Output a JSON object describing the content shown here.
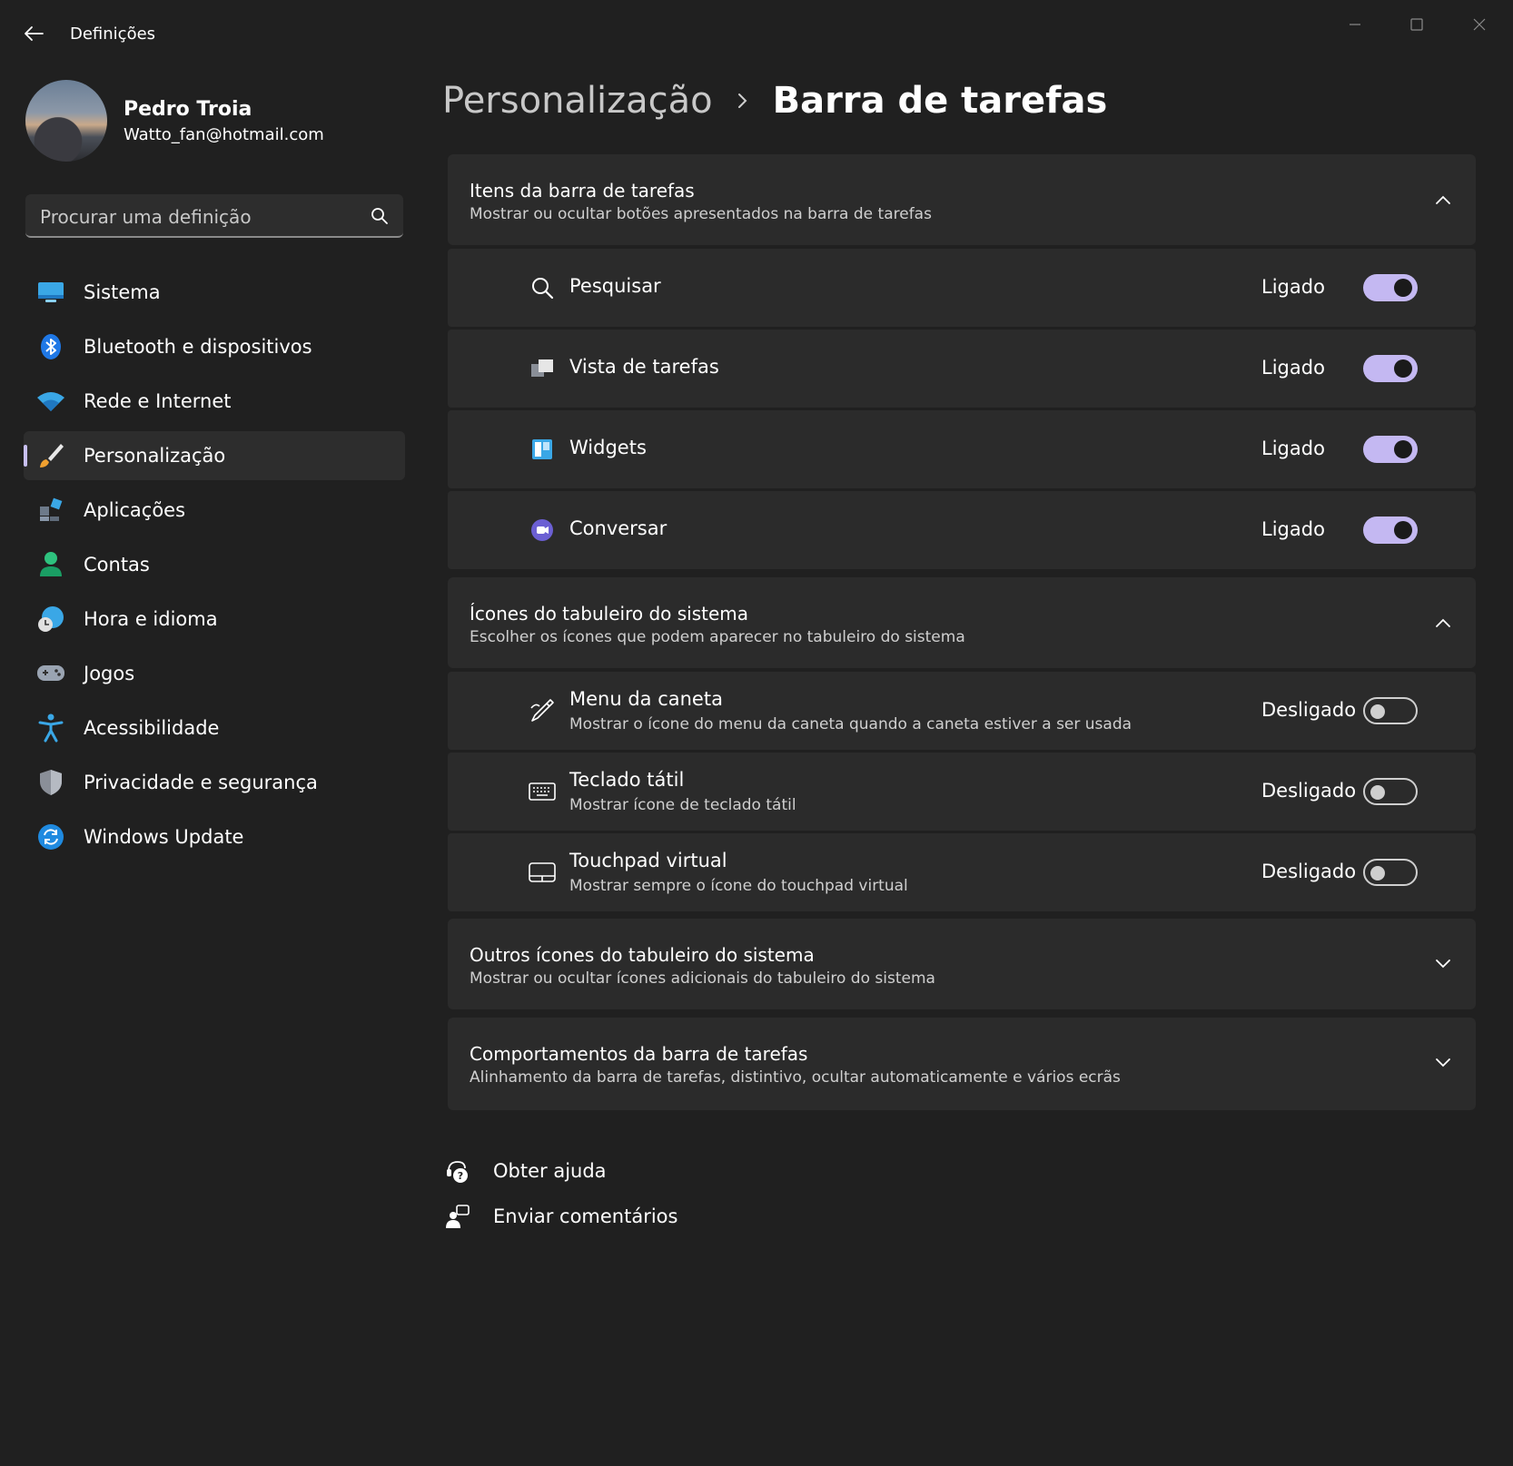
{
  "window": {
    "title": "Definições"
  },
  "profile": {
    "name": "Pedro Troia",
    "email": "Watto_fan@hotmail.com"
  },
  "search": {
    "placeholder": "Procurar uma definição"
  },
  "nav": {
    "items": [
      {
        "label": "Sistema",
        "icon": "monitor-icon"
      },
      {
        "label": "Bluetooth e dispositivos",
        "icon": "bluetooth-icon"
      },
      {
        "label": "Rede e Internet",
        "icon": "wifi-icon"
      },
      {
        "label": "Personalização",
        "icon": "brush-icon",
        "active": true
      },
      {
        "label": "Aplicações",
        "icon": "apps-icon"
      },
      {
        "label": "Contas",
        "icon": "person-icon"
      },
      {
        "label": "Hora e idioma",
        "icon": "globe-clock-icon"
      },
      {
        "label": "Jogos",
        "icon": "gamepad-icon"
      },
      {
        "label": "Acessibilidade",
        "icon": "accessibility-icon"
      },
      {
        "label": "Privacidade e segurança",
        "icon": "shield-icon"
      },
      {
        "label": "Windows Update",
        "icon": "update-icon"
      }
    ]
  },
  "breadcrumb": {
    "parent": "Personalização",
    "current": "Barra de tarefas"
  },
  "sections": {
    "taskbar_items": {
      "title": "Itens da barra de tarefas",
      "subtitle": "Mostrar ou ocultar botões apresentados na barra de tarefas",
      "expanded": true,
      "rows": [
        {
          "title": "Pesquisar",
          "state": "Ligado",
          "on": true,
          "icon": "search-icon"
        },
        {
          "title": "Vista de tarefas",
          "state": "Ligado",
          "on": true,
          "icon": "task-view-icon"
        },
        {
          "title": "Widgets",
          "state": "Ligado",
          "on": true,
          "icon": "widgets-icon"
        },
        {
          "title": "Conversar",
          "state": "Ligado",
          "on": true,
          "icon": "chat-icon"
        }
      ]
    },
    "tray_icons": {
      "title": "Ícones do tabuleiro do sistema",
      "subtitle": "Escolher os ícones que podem aparecer no tabuleiro do sistema",
      "expanded": true,
      "rows": [
        {
          "title": "Menu da caneta",
          "subtitle": "Mostrar o ícone do menu da caneta quando a caneta estiver a ser usada",
          "state": "Desligado",
          "on": false,
          "icon": "pen-icon"
        },
        {
          "title": "Teclado tátil",
          "subtitle": "Mostrar ícone de teclado tátil",
          "state": "Desligado",
          "on": false,
          "icon": "keyboard-icon"
        },
        {
          "title": "Touchpad virtual",
          "subtitle": "Mostrar sempre o ícone do touchpad virtual",
          "state": "Desligado",
          "on": false,
          "icon": "touchpad-icon"
        }
      ]
    },
    "other_tray": {
      "title": "Outros ícones do tabuleiro do sistema",
      "subtitle": "Mostrar ou ocultar ícones adicionais do tabuleiro do sistema",
      "expanded": false
    },
    "behaviors": {
      "title": "Comportamentos da barra de tarefas",
      "subtitle": "Alinhamento da barra de tarefas, distintivo, ocultar automaticamente e vários ecrãs",
      "expanded": false
    }
  },
  "footer": {
    "help": "Obter ajuda",
    "feedback": "Enviar comentários"
  },
  "colors": {
    "background": "#202020",
    "card": "#2b2b2b",
    "accent": "#c4b8f2"
  }
}
